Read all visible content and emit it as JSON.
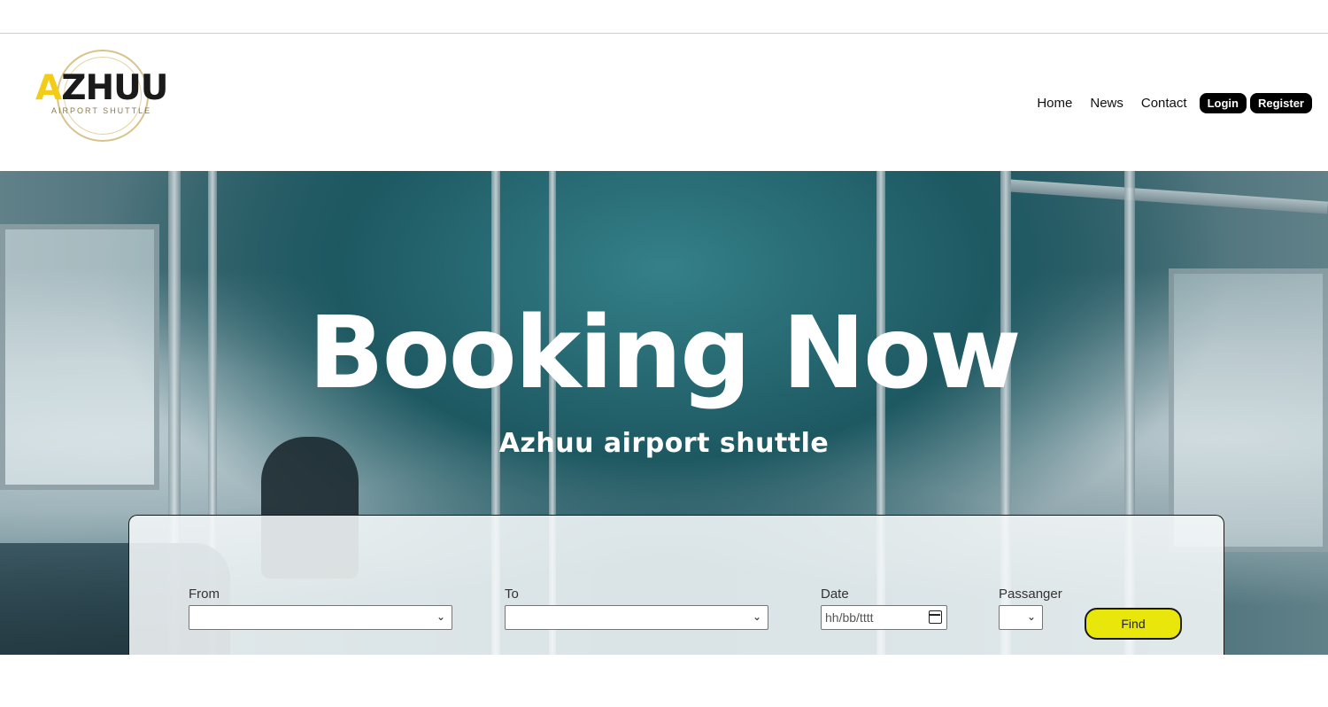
{
  "brand": {
    "logo_letter_a": "A",
    "logo_rest": "ZHUU",
    "logo_tagline": "AIRPORT SHUTTLE",
    "accent_color": "#f2cc17"
  },
  "nav": {
    "links": [
      "Home",
      "News",
      "Contact"
    ],
    "login_label": "Login",
    "register_label": "Register"
  },
  "hero": {
    "title": "Booking Now",
    "subtitle": "Azhuu airport shuttle"
  },
  "booking": {
    "from_label": "From",
    "from_value": "",
    "to_label": "To",
    "to_value": "",
    "date_label": "Date",
    "date_placeholder": "hh/bb/tttt",
    "passenger_label": "Passanger",
    "passenger_value": "",
    "find_label": "Find",
    "find_color": "#e8e60a"
  },
  "icons": {
    "dropdown": "chevron-down-icon",
    "calendar": "calendar-icon"
  }
}
